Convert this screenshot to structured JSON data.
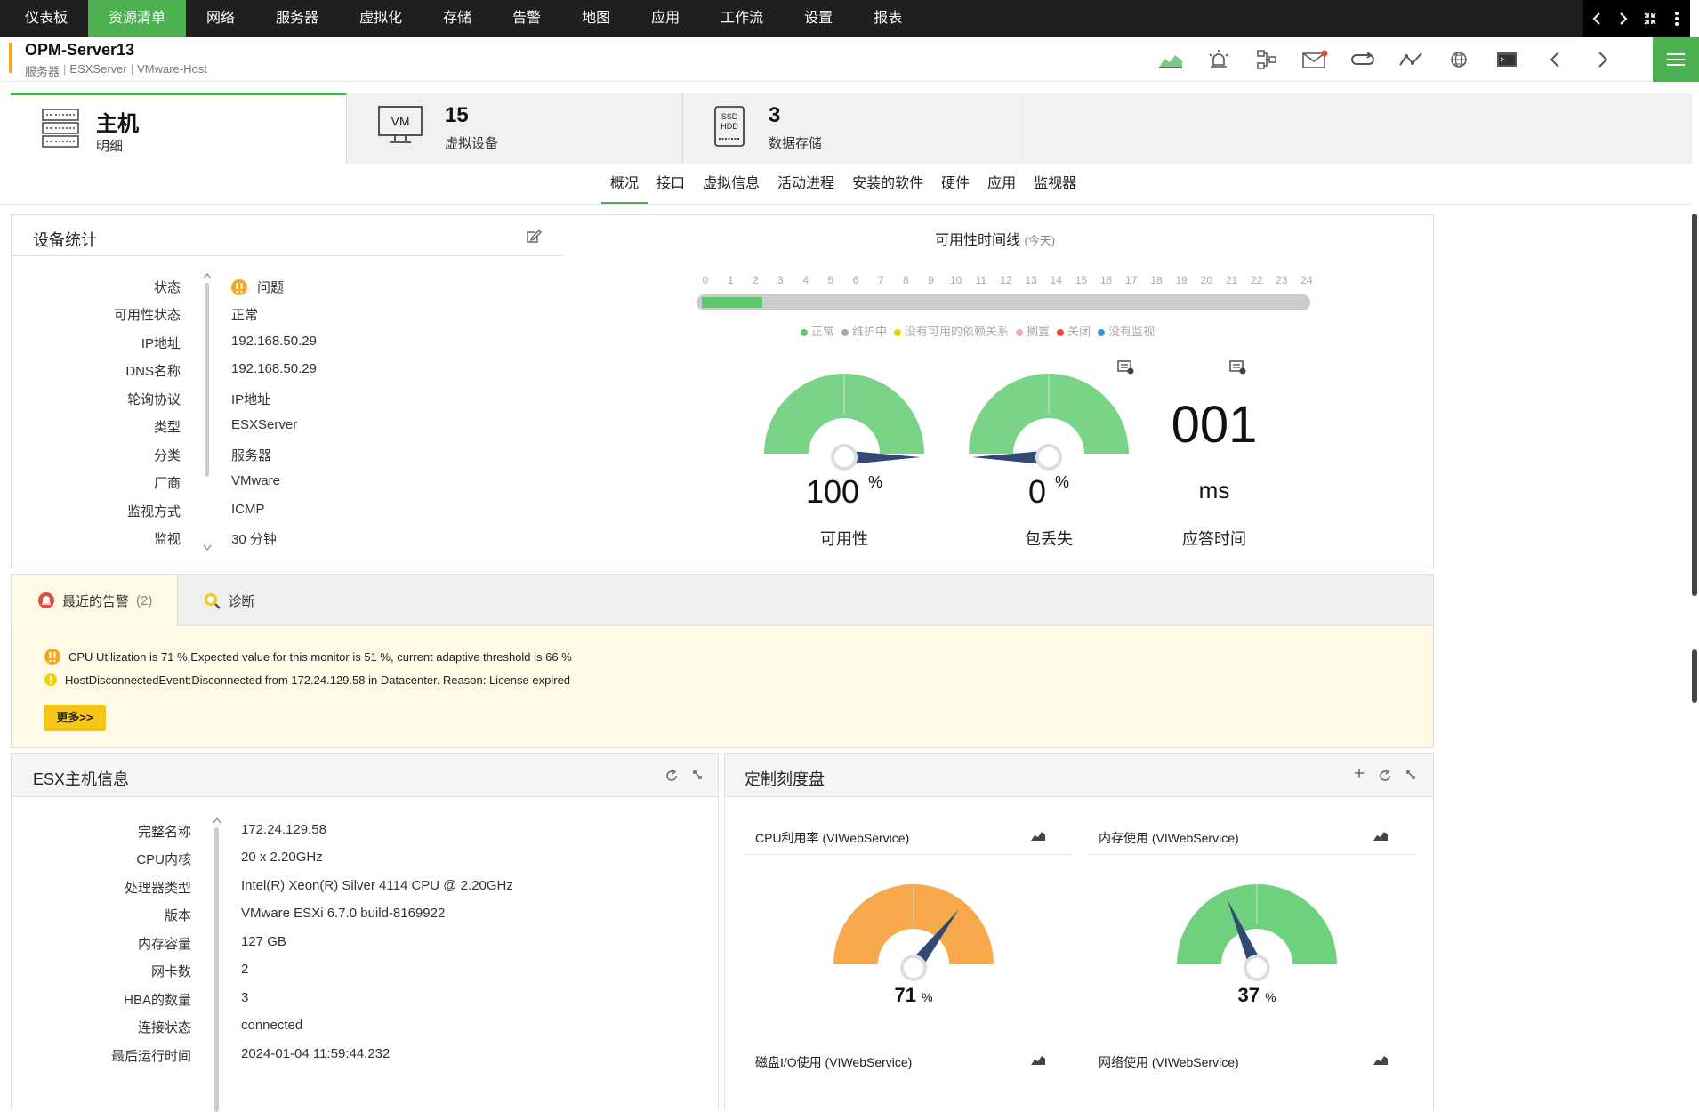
{
  "topnav": {
    "items": [
      "仪表板",
      "资源清单",
      "网络",
      "服务器",
      "虚拟化",
      "存储",
      "告警",
      "地图",
      "应用",
      "工作流",
      "设置",
      "报表"
    ],
    "active": "资源清单"
  },
  "title": {
    "name": "OPM-Server13",
    "crumb": [
      "服务器",
      "ESXServer",
      "VMware-Host"
    ]
  },
  "cards": {
    "host": {
      "big": "主机",
      "small": "明细"
    },
    "vm": {
      "big": "15",
      "small": "虚拟设备",
      "icon_text": "VM"
    },
    "store": {
      "big": "3",
      "small": "数据存储",
      "icon_text1": "SSD",
      "icon_text2": "HDD"
    }
  },
  "subtabs": [
    "概况",
    "接口",
    "虚拟信息",
    "活动进程",
    "安装的软件",
    "硬件",
    "应用",
    "监视器"
  ],
  "device_stats": {
    "title": "设备统计",
    "rows": [
      {
        "k": "状态",
        "v": "问题"
      },
      {
        "k": "可用性状态",
        "v": "正常"
      },
      {
        "k": "IP地址",
        "v": "192.168.50.29"
      },
      {
        "k": "DNS名称",
        "v": "192.168.50.29"
      },
      {
        "k": "轮询协议",
        "v": "IP地址"
      },
      {
        "k": "类型",
        "v": "ESXServer"
      },
      {
        "k": "分类",
        "v": "服务器"
      },
      {
        "k": "厂商",
        "v": "VMware"
      },
      {
        "k": "监视方式",
        "v": "ICMP"
      },
      {
        "k": "监视",
        "v": "30 分钟"
      }
    ]
  },
  "timeline": {
    "title": "可用性时间线",
    "sub": "(今天)",
    "hours": [
      "0",
      "1",
      "2",
      "3",
      "4",
      "5",
      "6",
      "7",
      "8",
      "9",
      "10",
      "11",
      "12",
      "13",
      "14",
      "15",
      "16",
      "17",
      "18",
      "19",
      "20",
      "21",
      "22",
      "23",
      "24"
    ],
    "legend": [
      {
        "label": "正常",
        "color": "#5cc86b"
      },
      {
        "label": "维护中",
        "color": "#aaaaaa"
      },
      {
        "label": "没有可用的依赖关系",
        "color": "#f5d000"
      },
      {
        "label": "搁置",
        "color": "#f4a6c0"
      },
      {
        "label": "关闭",
        "color": "#e74c3c"
      },
      {
        "label": "没有监视",
        "color": "#3498db"
      }
    ]
  },
  "gauges": {
    "availability": {
      "value": "100",
      "unit": "%",
      "label": "可用性"
    },
    "packetloss": {
      "value": "0",
      "unit": "%",
      "label": "包丢失"
    },
    "response": {
      "value": "001",
      "unit": "ms",
      "label": "应答时间"
    }
  },
  "alerts": {
    "tab_recent": "最近的告警",
    "tab_count": "(2)",
    "tab_diag": "诊断",
    "items": [
      "CPU Utilization is 71 %,Expected value for this monitor is 51 %, current adaptive threshold is 66 %",
      "HostDisconnectedEvent:Disconnected from 172.24.129.58 in Datacenter. Reason: License expired"
    ],
    "more": "更多>>"
  },
  "esx": {
    "title": "ESX主机信息",
    "rows": [
      {
        "k": "完整名称",
        "v": "172.24.129.58"
      },
      {
        "k": "CPU内核",
        "v": "20 x 2.20GHz"
      },
      {
        "k": "处理器类型",
        "v": "Intel(R) Xeon(R) Silver 4114 CPU @ 2.20GHz"
      },
      {
        "k": "版本",
        "v": "VMware ESXi 6.7.0 build-8169922"
      },
      {
        "k": "内存容量",
        "v": "127 GB"
      },
      {
        "k": "网卡数",
        "v": "2"
      },
      {
        "k": "HBA的数量",
        "v": "3"
      },
      {
        "k": "连接状态",
        "v": "connected"
      },
      {
        "k": "最后运行时间",
        "v": "2024-01-04 11:59:44.232"
      }
    ]
  },
  "custom": {
    "title": "定制刻度盘",
    "cpu": {
      "label": "CPU利用率 (VIWebService)",
      "value": "71",
      "unit": "%",
      "color": "#f7a94c"
    },
    "mem": {
      "label": "内存使用 (VIWebService)",
      "value": "37",
      "unit": "%",
      "color": "#6fd07d"
    },
    "disk": {
      "label": "磁盘I/O使用 (VIWebService)"
    },
    "net": {
      "label": "网络使用 (VIWebService)"
    }
  }
}
